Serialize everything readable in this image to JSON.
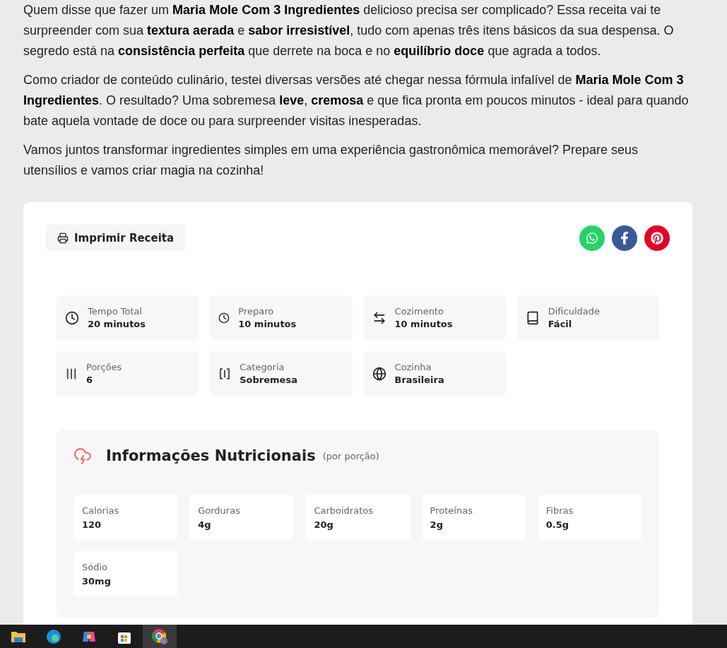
{
  "intro": [
    "Quem disse que fazer um **Maria Mole Com 3 Ingredientes** delicioso precisa ser complicado? Essa receita vai te surpreender com sua **textura aerada** e **sabor irresistível**, tudo com apenas três itens básicos da sua despensa. O segredo está na **consistência perfeita** que derrete na boca e no **equilíbrio doce** que agrada a todos.",
    "Como criador de conteúdo culinário, testei diversas versões até chegar nessa fórmula infalível de **Maria Mole Com 3 Ingredientes**. O resultado? Uma sobremesa **leve**, **cremosa** e que fica pronta em poucos minutos - ideal para quando bate aquela vontade de doce ou para surpreender visitas inesperadas.",
    "Vamos juntos transformar ingredientes simples em uma experiência gastronômica memorável? Prepare seus utensílios e vamos criar magia na cozinha!"
  ],
  "recipe": {
    "print_button": "Imprimir Receita",
    "share": [
      {
        "kind": "whatsapp",
        "color": "#25d366"
      },
      {
        "kind": "facebook",
        "color": "#3b5998"
      },
      {
        "kind": "pinterest",
        "color": "#e60023"
      }
    ],
    "details": [
      {
        "label": "Tempo Total",
        "value": "20 minutos"
      },
      {
        "label": "Preparo",
        "value": "10 minutos"
      },
      {
        "label": "Cozimento",
        "value": "10 minutos"
      },
      {
        "label": "Dificuldade",
        "value": "Fácil"
      },
      {
        "label": "Porções",
        "value": "6"
      },
      {
        "label": "Categoria",
        "value": "Sobremesa"
      },
      {
        "label": "Cozinha",
        "value": "Brasileira"
      }
    ],
    "nutrition": {
      "title": "Informações Nutricionais",
      "subtitle": "(por porção)",
      "items": [
        {
          "label": "Calorias",
          "value": "120"
        },
        {
          "label": "Gorduras",
          "value": "4g"
        },
        {
          "label": "Carboidratos",
          "value": "20g"
        },
        {
          "label": "Proteínas",
          "value": "2g"
        },
        {
          "label": "Fibras",
          "value": "0.5g"
        },
        {
          "label": "Sódio",
          "value": "30mg"
        }
      ]
    }
  },
  "taskbar": {
    "apps": [
      {
        "kind": "files",
        "selected": false
      },
      {
        "kind": "edge",
        "selected": false
      },
      {
        "kind": "copilot",
        "selected": false
      },
      {
        "kind": "store",
        "selected": false
      },
      {
        "kind": "chrome",
        "selected": true
      }
    ]
  }
}
